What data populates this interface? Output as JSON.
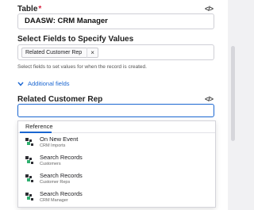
{
  "table": {
    "label": "Table",
    "required": "*",
    "value": "DAASW: CRM Manager"
  },
  "select_fields": {
    "label": "Select Fields to Specify Values",
    "chip": "Related Customer Rep",
    "chip_remove": "×",
    "helper": "Select fields to set values for when the record is created."
  },
  "additional_fields": {
    "label": "Additional fields"
  },
  "related": {
    "label": "Related Customer Rep",
    "value": ""
  },
  "dropdown": {
    "tab": "Reference",
    "items": [
      {
        "title": "On New Event",
        "subtitle": "CRM Imports"
      },
      {
        "title": "Search Records",
        "subtitle": "Customers"
      },
      {
        "title": "Search Records",
        "subtitle": "Customer Reps"
      },
      {
        "title": "Search Records",
        "subtitle": "CRM Manager"
      }
    ]
  },
  "icons": {
    "code": "code-brackets-icon",
    "chevron": "chevron-down-icon",
    "item": "integration-icon"
  },
  "colors": {
    "accent": "#1a66d1",
    "required": "#d6203e"
  }
}
